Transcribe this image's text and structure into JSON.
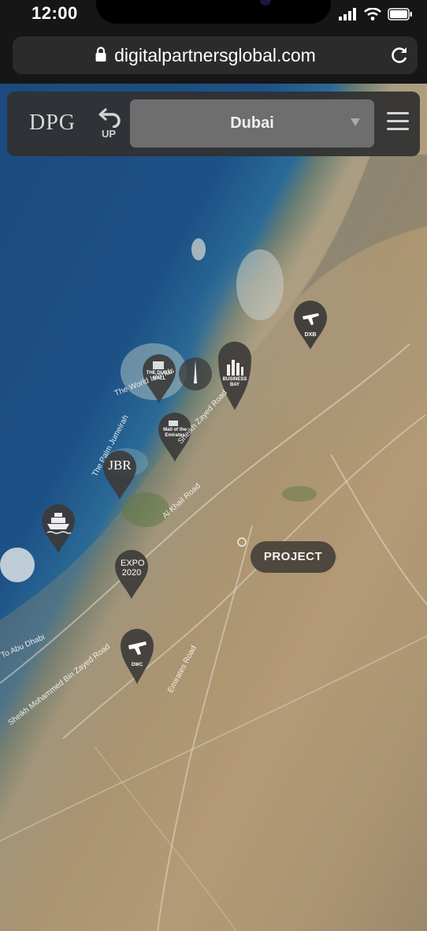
{
  "status": {
    "time": "12:00"
  },
  "browser": {
    "url": "digitalpartnersglobal.com"
  },
  "header": {
    "logo": "DPG",
    "up_label": "UP",
    "city_selected": "Dubai"
  },
  "map": {
    "project_label": "PROJECT",
    "pins": [
      {
        "name": "airport-dxb",
        "label": "DXB"
      },
      {
        "name": "business-bay",
        "label": "BUSINESS BAY"
      },
      {
        "name": "dubai-mall",
        "label": "THE DUBAI MALL"
      },
      {
        "name": "mall-of-emirates",
        "label": "Mall of the Emirates"
      },
      {
        "name": "jbr",
        "label": "JBR"
      },
      {
        "name": "cruise-terminal",
        "label": ""
      },
      {
        "name": "expo-2020",
        "label": "EXPO 2020"
      },
      {
        "name": "airport-dwc",
        "label": "DWC"
      }
    ],
    "road_labels": {
      "world_islands": "The World Islands",
      "palm": "The Palm Jumeirah",
      "szr": "Sheikh Zayed Road",
      "alkhail": "Al Khail Road",
      "abudhabi": "To Abu Dhabi",
      "mbz": "Sheikh Mohammed Bin Zayed Road",
      "emirates": "Emirates Road"
    }
  },
  "colors": {
    "pin": "#3c3a38",
    "ocean": "#1d5186",
    "desert": "#c5a57b"
  }
}
